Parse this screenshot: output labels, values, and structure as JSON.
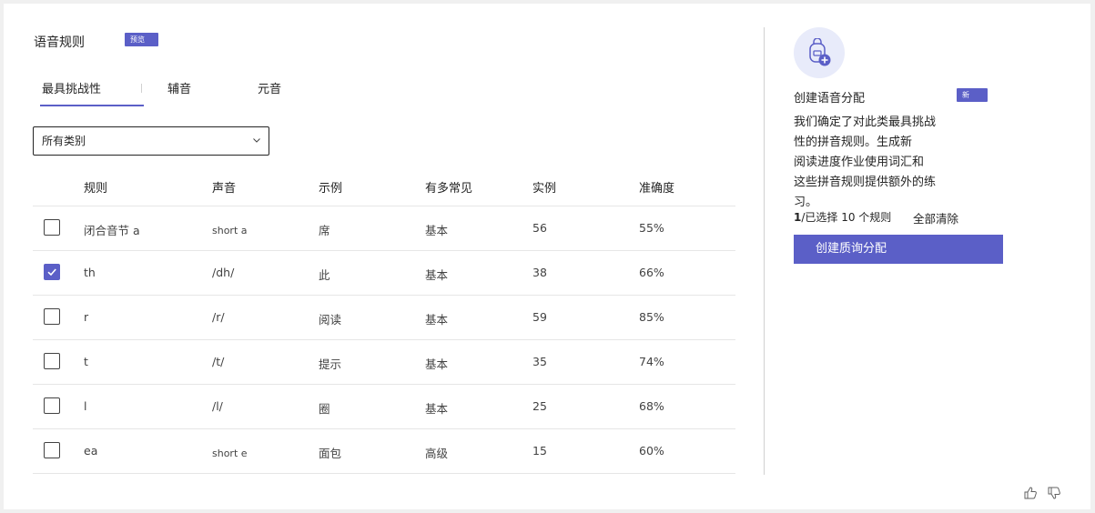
{
  "header": {
    "title": "语音规则",
    "title_badge": "预览"
  },
  "tabs": [
    {
      "label": "最具挑战性",
      "active": true
    },
    {
      "label": "辅音",
      "active": false
    },
    {
      "label": "元音",
      "active": false
    }
  ],
  "filter": {
    "selected": "所有类别"
  },
  "table": {
    "columns": [
      "规则",
      "声音",
      "示例",
      "有多常见",
      "实例",
      "准确度"
    ],
    "rows": [
      {
        "checked": false,
        "rule": "闭合音节 a",
        "sound": "short a",
        "example": "席",
        "frequency": "基本",
        "instances": "56",
        "accuracy": "55%"
      },
      {
        "checked": true,
        "rule": "th",
        "sound": "/dh/",
        "example": "此",
        "frequency": "基本",
        "instances": "38",
        "accuracy": "66%"
      },
      {
        "checked": false,
        "rule": "r",
        "sound": "/r/",
        "example": "阅读",
        "frequency": "基本",
        "instances": "59",
        "accuracy": "85%"
      },
      {
        "checked": false,
        "rule": "t",
        "sound": "/t/",
        "example": "提示",
        "frequency": "基本",
        "instances": "35",
        "accuracy": "74%"
      },
      {
        "checked": false,
        "rule": "l",
        "sound": "/l/",
        "example": "圈",
        "frequency": "基本",
        "instances": "25",
        "accuracy": "68%"
      },
      {
        "checked": false,
        "rule": "ea",
        "sound": "short e",
        "example": "面包",
        "frequency": "高级",
        "instances": "15",
        "accuracy": "60%"
      }
    ]
  },
  "right_panel": {
    "icon": "backpack-add-icon",
    "title": "创建语音分配",
    "title_badge": "新",
    "description": "我们确定了对此类最具挑战性的拼音规则。生成新阅读进度作业使用词汇和这些拼音规则提供额外的练习。",
    "description_lines": [
      "我们确定了对此类最具挑战",
      "性的拼音规则。生成新",
      "阅读进度作业使用词汇和",
      "这些拼音规则提供额外的练习。"
    ],
    "selected_count": "1",
    "selected_text": "/已选择 10 个规则",
    "clear_all": "全部清除",
    "create_button": "创建质询分配"
  },
  "feedback": {
    "like_icon": "thumbs-up-icon",
    "dislike_icon": "thumbs-down-icon"
  },
  "colors": {
    "accent": "#5b5fc7",
    "avatar_bg": "#e8ebfa"
  }
}
